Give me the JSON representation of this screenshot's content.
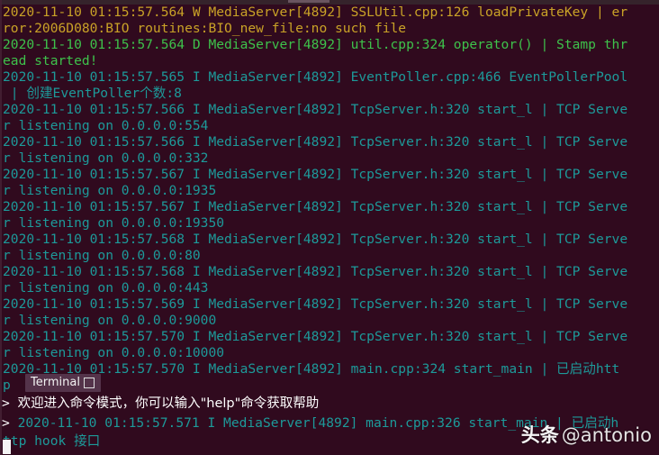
{
  "window": {
    "title": "Terminal",
    "background_color": "#300a1e",
    "top_strip_color": "#35232b"
  },
  "palette": {
    "warn": "#c9a227",
    "debug": "#3ec24b",
    "info": "#1d9a9a",
    "prompt": "#ffffff",
    "background": "#300a1e"
  },
  "overlay": {
    "chip_label": "Terminal"
  },
  "watermark": {
    "cn": "头条",
    "handle": "@antonio"
  },
  "terminal": {
    "lines": [
      {
        "level": "W",
        "color": "warn",
        "text": "2020-11-10 01:15:57.564 W MediaServer[4892] SSLUtil.cpp:126 loadPrivateKey | er"
      },
      {
        "level": "W",
        "color": "warn",
        "text": "ror:2006D080:BIO routines:BIO_new_file:no such file"
      },
      {
        "level": "D",
        "color": "debug",
        "text": "2020-11-10 01:15:57.564 D MediaServer[4892] util.cpp:324 operator() | Stamp thr"
      },
      {
        "level": "D",
        "color": "debug",
        "text": "ead started!"
      },
      {
        "level": "I",
        "color": "info",
        "text": "2020-11-10 01:15:57.565 I MediaServer[4892] EventPoller.cpp:466 EventPollerPool"
      },
      {
        "level": "I",
        "color": "info",
        "text": " | 创建EventPoller个数:8"
      },
      {
        "level": "I",
        "color": "info",
        "text": "2020-11-10 01:15:57.566 I MediaServer[4892] TcpServer.h:320 start_l | TCP Serve"
      },
      {
        "level": "I",
        "color": "info",
        "text": "r listening on 0.0.0.0:554"
      },
      {
        "level": "I",
        "color": "info",
        "text": "2020-11-10 01:15:57.566 I MediaServer[4892] TcpServer.h:320 start_l | TCP Serve"
      },
      {
        "level": "I",
        "color": "info",
        "text": "r listening on 0.0.0.0:332"
      },
      {
        "level": "I",
        "color": "info",
        "text": "2020-11-10 01:15:57.567 I MediaServer[4892] TcpServer.h:320 start_l | TCP Serve"
      },
      {
        "level": "I",
        "color": "info",
        "text": "r listening on 0.0.0.0:1935"
      },
      {
        "level": "I",
        "color": "info",
        "text": "2020-11-10 01:15:57.567 I MediaServer[4892] TcpServer.h:320 start_l | TCP Serve"
      },
      {
        "level": "I",
        "color": "info",
        "text": "r listening on 0.0.0.0:19350"
      },
      {
        "level": "I",
        "color": "info",
        "text": "2020-11-10 01:15:57.568 I MediaServer[4892] TcpServer.h:320 start_l | TCP Serve"
      },
      {
        "level": "I",
        "color": "info",
        "text": "r listening on 0.0.0.0:80"
      },
      {
        "level": "I",
        "color": "info",
        "text": "2020-11-10 01:15:57.568 I MediaServer[4892] TcpServer.h:320 start_l | TCP Serve"
      },
      {
        "level": "I",
        "color": "info",
        "text": "r listening on 0.0.0.0:443"
      },
      {
        "level": "I",
        "color": "info",
        "text": "2020-11-10 01:15:57.569 I MediaServer[4892] TcpServer.h:320 start_l | TCP Serve"
      },
      {
        "level": "I",
        "color": "info",
        "text": "r listening on 0.0.0.0:9000"
      },
      {
        "level": "I",
        "color": "info",
        "text": "2020-11-10 01:15:57.570 I MediaServer[4892] TcpServer.h:320 start_l | TCP Serve"
      },
      {
        "level": "I",
        "color": "info",
        "text": "r listening on 0.0.0.0:10000"
      },
      {
        "level": "I",
        "color": "info",
        "text": "2020-11-10 01:15:57.570 I MediaServer[4892] main.cpp:324 start_main | 已启动htt"
      },
      {
        "level": "I",
        "color": "info",
        "text": "p"
      }
    ],
    "prompt_lines": [
      {
        "marker": ">",
        "style": "cn",
        "text": "欢迎进入命令模式，你可以输入\"help\"命令获取帮助"
      },
      {
        "marker": ">",
        "style": "mono",
        "text": "2020-11-10 01:15:57.571 I MediaServer[4892] main.cpp:326 start_main | 已启动h"
      }
    ],
    "tail_line": "ttp hook 接口",
    "listening_ports": [
      554,
      332,
      1935,
      19350,
      80,
      443,
      9000,
      10000
    ],
    "process_name": "MediaServer",
    "pid": "4892",
    "event_poller_count": "8"
  }
}
